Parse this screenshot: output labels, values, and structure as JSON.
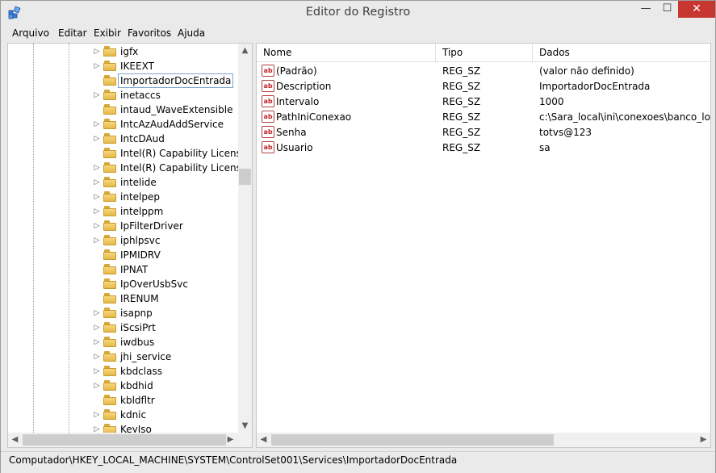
{
  "window": {
    "title": "Editor do Registro",
    "close_glyph": "✕",
    "minimize_glyph": "—",
    "maximize_glyph": "☐"
  },
  "menu": [
    "Arquivo",
    "Editar",
    "Exibir",
    "Favoritos",
    "Ajuda"
  ],
  "tree": {
    "items": [
      {
        "label": "igfx",
        "expandable": true
      },
      {
        "label": "IKEEXT",
        "expandable": true
      },
      {
        "label": "ImportadorDocEntrada",
        "expandable": false,
        "selected": true
      },
      {
        "label": "inetaccs",
        "expandable": true
      },
      {
        "label": "intaud_WaveExtensible",
        "expandable": false
      },
      {
        "label": "IntcAzAudAddService",
        "expandable": true
      },
      {
        "label": "IntcDAud",
        "expandable": true
      },
      {
        "label": "Intel(R) Capability Licensing",
        "expandable": false
      },
      {
        "label": "Intel(R) Capability Licensing",
        "expandable": true
      },
      {
        "label": "intelide",
        "expandable": true
      },
      {
        "label": "intelpep",
        "expandable": true
      },
      {
        "label": "intelppm",
        "expandable": true
      },
      {
        "label": "IpFilterDriver",
        "expandable": true
      },
      {
        "label": "iphlpsvc",
        "expandable": true
      },
      {
        "label": "IPMIDRV",
        "expandable": false
      },
      {
        "label": "IPNAT",
        "expandable": false
      },
      {
        "label": "IpOverUsbSvc",
        "expandable": false
      },
      {
        "label": "IRENUM",
        "expandable": false
      },
      {
        "label": "isapnp",
        "expandable": true
      },
      {
        "label": "iScsiPrt",
        "expandable": true
      },
      {
        "label": "iwdbus",
        "expandable": true
      },
      {
        "label": "jhi_service",
        "expandable": true
      },
      {
        "label": "kbdclass",
        "expandable": true
      },
      {
        "label": "kbdhid",
        "expandable": true
      },
      {
        "label": "kbldfltr",
        "expandable": false
      },
      {
        "label": "kdnic",
        "expandable": true
      },
      {
        "label": "KeyIso",
        "expandable": true
      }
    ]
  },
  "values_list": {
    "columns": [
      "Nome",
      "Tipo",
      "Dados"
    ],
    "rows": [
      {
        "name": "(Padrão)",
        "type": "REG_SZ",
        "data": "(valor não definido)"
      },
      {
        "name": "Description",
        "type": "REG_SZ",
        "data": "ImportadorDocEntrada"
      },
      {
        "name": "Intervalo",
        "type": "REG_SZ",
        "data": "1000"
      },
      {
        "name": "PathIniConexao",
        "type": "REG_SZ",
        "data": "c:\\Sara_local\\ini\\conexoes\\banco_local.ini"
      },
      {
        "name": "Senha",
        "type": "REG_SZ",
        "data": "totvs@123"
      },
      {
        "name": "Usuario",
        "type": "REG_SZ",
        "data": "sa"
      }
    ],
    "value_icon_text": "ab"
  },
  "status": {
    "path": "Computador\\HKEY_LOCAL_MACHINE\\SYSTEM\\ControlSet001\\Services\\ImportadorDocEntrada"
  },
  "icons": {
    "expand": "▷",
    "scroll_up": "▲",
    "scroll_down": "▼",
    "scroll_left": "◀",
    "scroll_right": "▶",
    "app": "registry-editor-icon"
  },
  "colors": {
    "close_button": "#c7372f",
    "value_icon": "#c0242a",
    "folder": "#e5b84a"
  }
}
